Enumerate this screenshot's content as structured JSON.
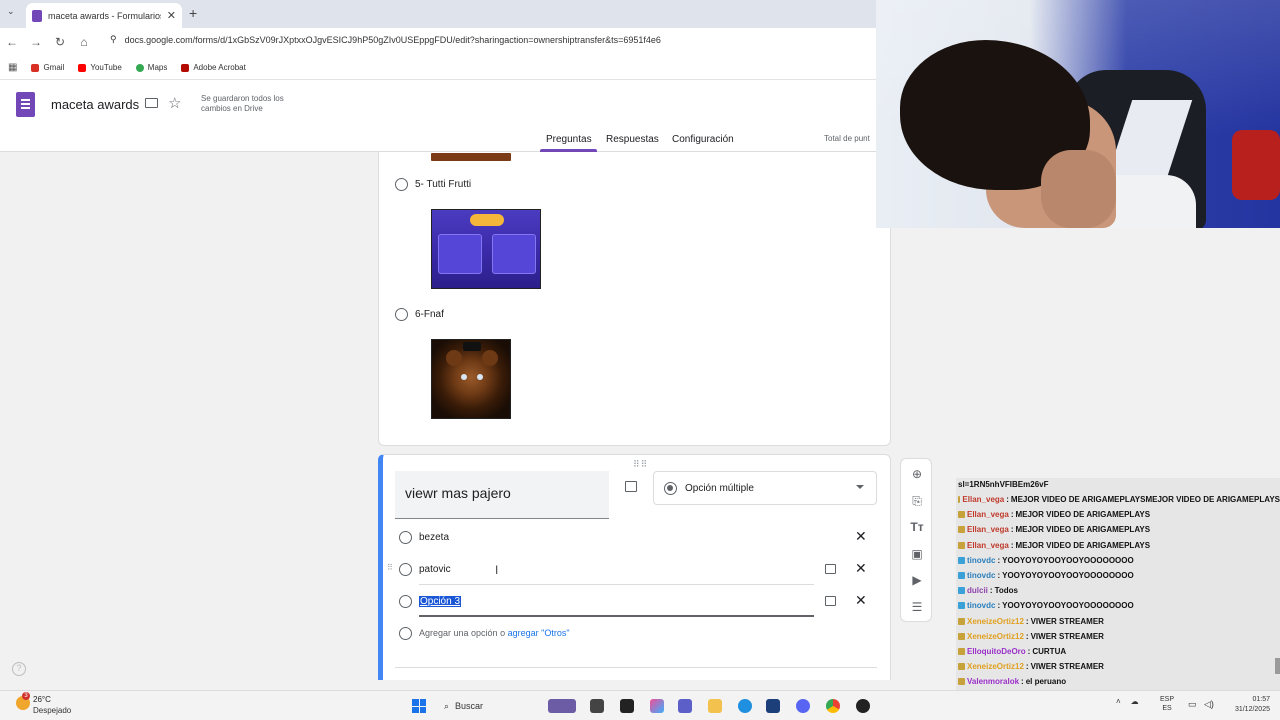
{
  "browser": {
    "tab_title": "maceta awards - Formularios d",
    "url": "docs.google.com/forms/d/1xGbSzV09rJXptxxOJgvESICJ9hP50gZIv0USEppgFDU/edit?sharingaction=ownershiptransfer&ts=6951f4e6",
    "bookmarks": [
      "Gmail",
      "YouTube",
      "Maps",
      "Adobe Acrobat"
    ]
  },
  "forms": {
    "title": "maceta awards",
    "saved_msg": "Se guardaron todos los cambios en Drive",
    "tabs": [
      "Preguntas",
      "Respuestas",
      "Configuración"
    ],
    "total_points": "Total de punt"
  },
  "card1": {
    "options": [
      {
        "label": "5- Tutti Frutti"
      },
      {
        "label": "6-Fnaf"
      }
    ]
  },
  "card2": {
    "question": "viewr mas pajero",
    "type_label": "Opción múltiple",
    "options": [
      {
        "label": "bezeta"
      },
      {
        "label": "patovic"
      },
      {
        "label": "Opción 3"
      }
    ],
    "add_option": "Agregar una opción",
    "or_text": "o",
    "add_other": "agregar \"Otros\""
  },
  "chat": {
    "title": "sl=1RN5nhVFIBEm26vF",
    "messages": [
      {
        "user": "Ellan_vega",
        "text": "MEJOR VIDEO DE ARIGAMEPLAYSMEJOR VIDEO DE ARIGAMEPLAYS",
        "user_color": "#c0392b",
        "badge": "#c7a23a"
      },
      {
        "user": "Ellan_vega",
        "text": "MEJOR VIDEO DE ARIGAMEPLAYS",
        "user_color": "#c0392b",
        "badge": "#c7a23a"
      },
      {
        "user": "Ellan_vega",
        "text": "MEJOR VIDEO DE ARIGAMEPLAYS",
        "user_color": "#c0392b",
        "badge": "#c7a23a"
      },
      {
        "user": "Ellan_vega",
        "text": "MEJOR VIDEO DE ARIGAMEPLAYS",
        "user_color": "#c0392b",
        "badge": "#c7a23a"
      },
      {
        "user": "tinovdc",
        "text": "YOOYOYOYOOYOOYOOOOOOOO",
        "user_color": "#2a7fbd",
        "badge": "#3aa0d8"
      },
      {
        "user": "tinovdc",
        "text": "YOOYOYOYOOYOOYOOOOOOOO",
        "user_color": "#2a7fbd",
        "badge": "#3aa0d8"
      },
      {
        "user": "dulcii",
        "text": "Todos",
        "user_color": "#8e44ad",
        "badge": "#3aa0d8"
      },
      {
        "user": "tinovdc",
        "text": "YOOYOYOYOOYOOYOOOOOOOO",
        "user_color": "#2a7fbd",
        "badge": "#3aa0d8"
      },
      {
        "user": "XeneizeOrtiz12",
        "text": "VIWER STREAMER",
        "user_color": "#e0a020",
        "badge": "#c7a23a"
      },
      {
        "user": "XeneizeOrtiz12",
        "text": "VIWER STREAMER",
        "user_color": "#e0a020",
        "badge": "#c7a23a"
      },
      {
        "user": "ElloquitoDeOro",
        "text": "CURTUA",
        "user_color": "#9b30c8",
        "badge": "#c7a23a"
      },
      {
        "user": "XeneizeOrtiz12",
        "text": "VIWER STREAMER",
        "user_color": "#e0a020",
        "badge": "#c7a23a"
      },
      {
        "user": "Valenmoralok",
        "text": "el peruano",
        "user_color": "#9b30c8",
        "badge": "#c7a23a"
      },
      {
        "user": "XeneizeOrtiz12",
        "text": "VIWER STREAMER",
        "user_color": "#e0a020",
        "badge": "#c7a23a"
      }
    ]
  },
  "taskbar": {
    "temp": "26°C",
    "weather": "Despejado",
    "weather_badge": "3",
    "search": "Buscar",
    "lang_top": "ESP",
    "lang_bottom": "ES",
    "time": "01:57",
    "date": "31/12/2025"
  }
}
